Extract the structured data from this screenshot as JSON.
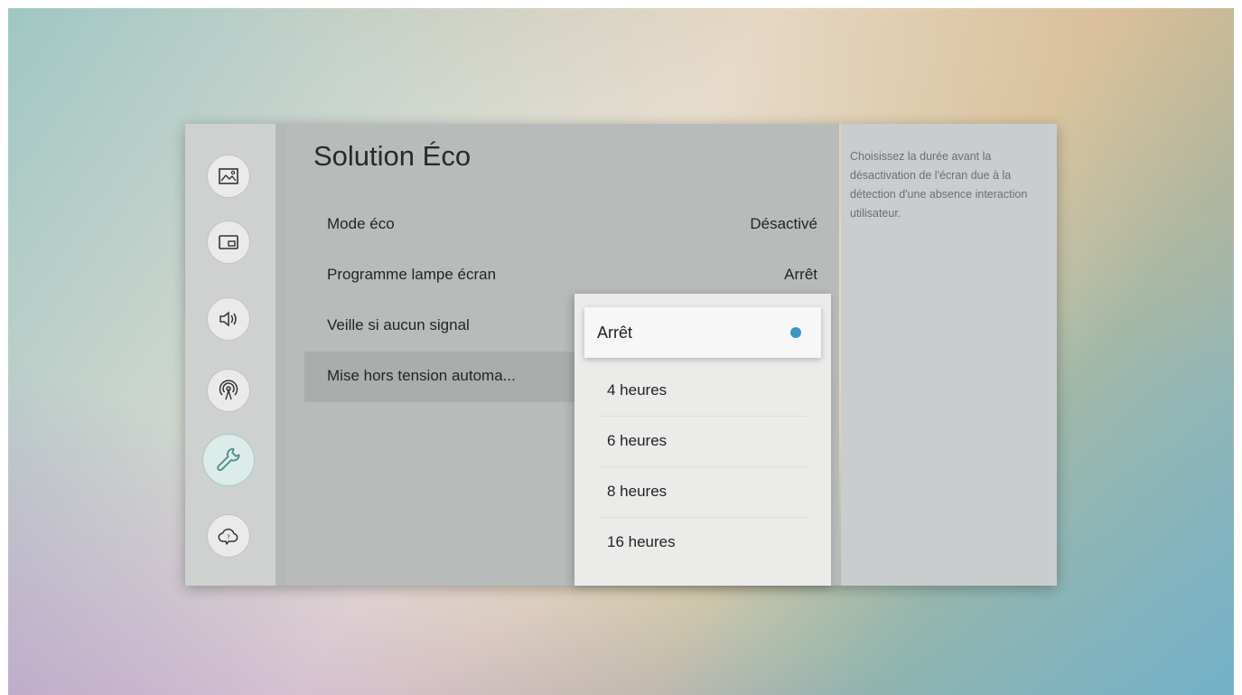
{
  "title": "Solution Éco",
  "sidebar": {
    "items": [
      {
        "name": "picture",
        "icon": "picture-icon"
      },
      {
        "name": "picture-in-picture",
        "icon": "picture-in-picture-icon"
      },
      {
        "name": "sound",
        "icon": "sound-icon"
      },
      {
        "name": "broadcast",
        "icon": "broadcast-icon"
      },
      {
        "name": "general",
        "icon": "wrench-icon",
        "active": true
      },
      {
        "name": "support",
        "icon": "support-cloud-icon"
      }
    ]
  },
  "settings": [
    {
      "label": "Mode éco",
      "value": "Désactivé"
    },
    {
      "label": "Programme lampe écran",
      "value": "Arrêt"
    },
    {
      "label": "Veille si aucun signal",
      "value": ""
    },
    {
      "label": "Mise hors tension automa...",
      "value": ""
    }
  ],
  "dropdown": {
    "options": [
      "Arrêt",
      "4 heures",
      "6 heures",
      "8 heures",
      "16 heures"
    ],
    "selected_index": 0
  },
  "help": {
    "text": "Choisissez la durée avant la désactivation de l'écran due à la détection d'une absence interaction utilisateur."
  },
  "colors": {
    "check_accent": "#3e95c6",
    "active_icon_bg": "#dbece9"
  }
}
